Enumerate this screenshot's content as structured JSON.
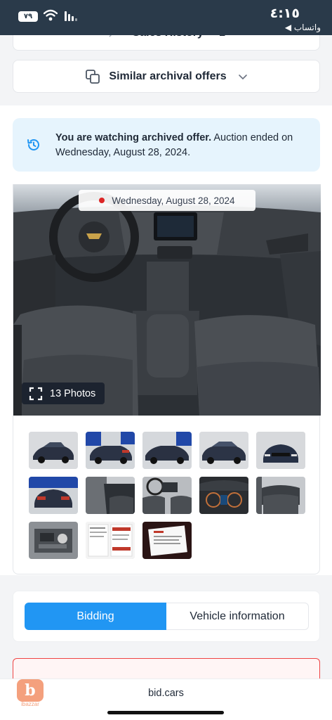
{
  "status_bar": {
    "time": "٤:١٥",
    "battery": "٧٩",
    "back_app": "◀ واتساب"
  },
  "sales_history": {
    "label": "Sales History",
    "count": "1"
  },
  "similar": {
    "label": "Similar archival offers"
  },
  "alert": {
    "bold_text": "You are watching archived offer.",
    "rest_text": " Auction ended on Wednesday, August 28, 2024."
  },
  "gallery": {
    "date": "Wednesday, August 28, 2024",
    "photos_label": "13 Photos",
    "thumbnails": [
      {
        "name": "front-left exterior"
      },
      {
        "name": "rear-left exterior"
      },
      {
        "name": "front-right exterior"
      },
      {
        "name": "side exterior"
      },
      {
        "name": "front exterior"
      },
      {
        "name": "rear exterior"
      },
      {
        "name": "driver interior"
      },
      {
        "name": "dashboard interior"
      },
      {
        "name": "instrument cluster"
      },
      {
        "name": "rear seats"
      },
      {
        "name": "engine bay"
      },
      {
        "name": "window sticker"
      },
      {
        "name": "monroney label"
      }
    ]
  },
  "tabs": {
    "bidding": "Bidding",
    "vehicle": "Vehicle information"
  },
  "bottom": {
    "logo_letter": "b",
    "logo_text": "ibazzar",
    "domain": "bid.cars"
  },
  "colors": {
    "accent": "#2196f3",
    "alert_bg": "#e6f4fd",
    "status_bar": "#2a3a4a"
  }
}
